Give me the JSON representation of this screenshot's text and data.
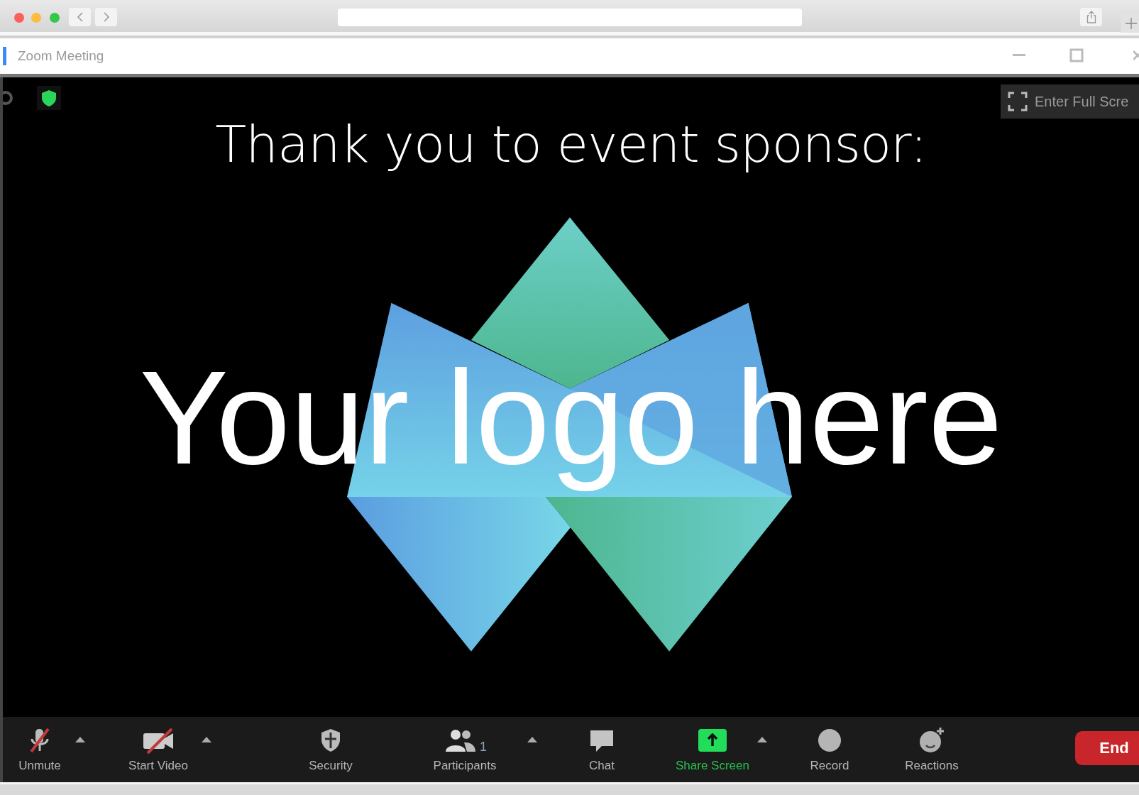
{
  "window": {
    "title": "Zoom Meeting"
  },
  "stage": {
    "fullscreen_button": "Enter Full Scre",
    "heading": "Thank you to event sponsor:",
    "logo_text": "Your logo here"
  },
  "toolbar": [
    {
      "kind": "tool",
      "label": "Unmute",
      "highlighted": false
    },
    {
      "kind": "caret"
    },
    {
      "kind": "tool",
      "label": "Start Video",
      "highlighted": false
    },
    {
      "kind": "caret"
    },
    {
      "kind": "tool",
      "label": "Security",
      "highlighted": false
    },
    {
      "kind": "tool",
      "label": "Participants",
      "count": "1",
      "highlighted": false
    },
    {
      "kind": "caret"
    },
    {
      "kind": "tool",
      "label": "Chat",
      "highlighted": false
    },
    {
      "kind": "tool",
      "label": "Share Screen",
      "highlighted": true
    },
    {
      "kind": "caret"
    },
    {
      "kind": "tool",
      "label": "Record",
      "highlighted": false
    },
    {
      "kind": "tool",
      "label": "Reactions",
      "highlighted": false
    }
  ],
  "end_button": {
    "label": "End"
  }
}
